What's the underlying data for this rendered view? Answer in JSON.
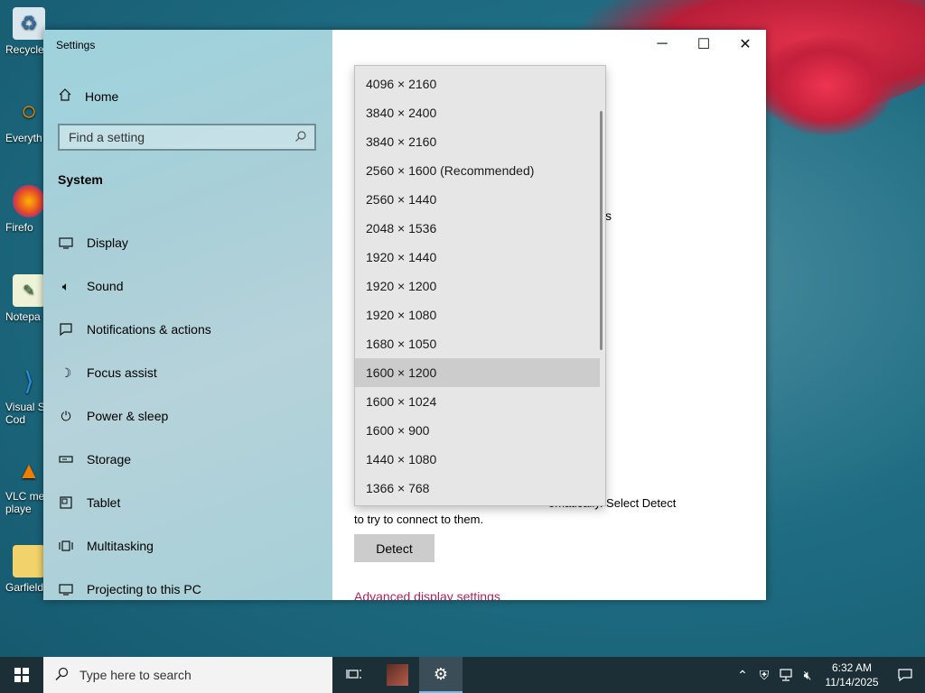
{
  "desktop": {
    "icons": [
      {
        "label": "Recycle",
        "icon": "recycle-bin-icon"
      },
      {
        "label": "Everyth",
        "icon": "everything-search-icon"
      },
      {
        "label": "Firefo",
        "icon": "firefox-icon"
      },
      {
        "label": "Notepa",
        "icon": "notepad-icon"
      },
      {
        "label": "Visual St Cod",
        "icon": "vscode-icon"
      },
      {
        "label": "VLC me playe",
        "icon": "vlc-icon"
      },
      {
        "label": "Garfieldi",
        "icon": "folder-icon"
      }
    ]
  },
  "window": {
    "title": "Settings",
    "home_label": "Home",
    "search_placeholder": "Find a setting",
    "section_title": "System",
    "nav": [
      {
        "label": "Display",
        "icon": "display-icon"
      },
      {
        "label": "Sound",
        "icon": "sound-icon"
      },
      {
        "label": "Notifications & actions",
        "icon": "notifications-icon"
      },
      {
        "label": "Focus assist",
        "icon": "moon-icon"
      },
      {
        "label": "Power & sleep",
        "icon": "power-icon"
      },
      {
        "label": "Storage",
        "icon": "storage-icon"
      },
      {
        "label": "Tablet",
        "icon": "tablet-icon"
      },
      {
        "label": "Multitasking",
        "icon": "multitasking-icon"
      },
      {
        "label": "Projecting to this PC",
        "icon": "projecting-icon"
      }
    ],
    "caption": {
      "minimize": "─",
      "maximize": "☐",
      "close": "✕"
    },
    "content": {
      "detect_text_line1": "omatically. Select Detect",
      "detect_text_line2": "to try to connect to them.",
      "detect_button": "Detect",
      "advanced_link": "Advanced display settings",
      "stray_char": "s"
    }
  },
  "resolution_dropdown": {
    "selected": "1600 × 1200",
    "options": [
      "4096 × 2160",
      "3840 × 2400",
      "3840 × 2160",
      "2560 × 1600 (Recommended)",
      "2560 × 1440",
      "2048 × 1536",
      "1920 × 1440",
      "1920 × 1200",
      "1920 × 1080",
      "1680 × 1050",
      "1600 × 1200",
      "1600 × 1024",
      "1600 × 900",
      "1440 × 1080",
      "1366 × 768"
    ]
  },
  "taskbar": {
    "search_placeholder": "Type here to search",
    "time": "6:32 AM",
    "date": "11/14/2025",
    "accent": "#76b9ed"
  }
}
